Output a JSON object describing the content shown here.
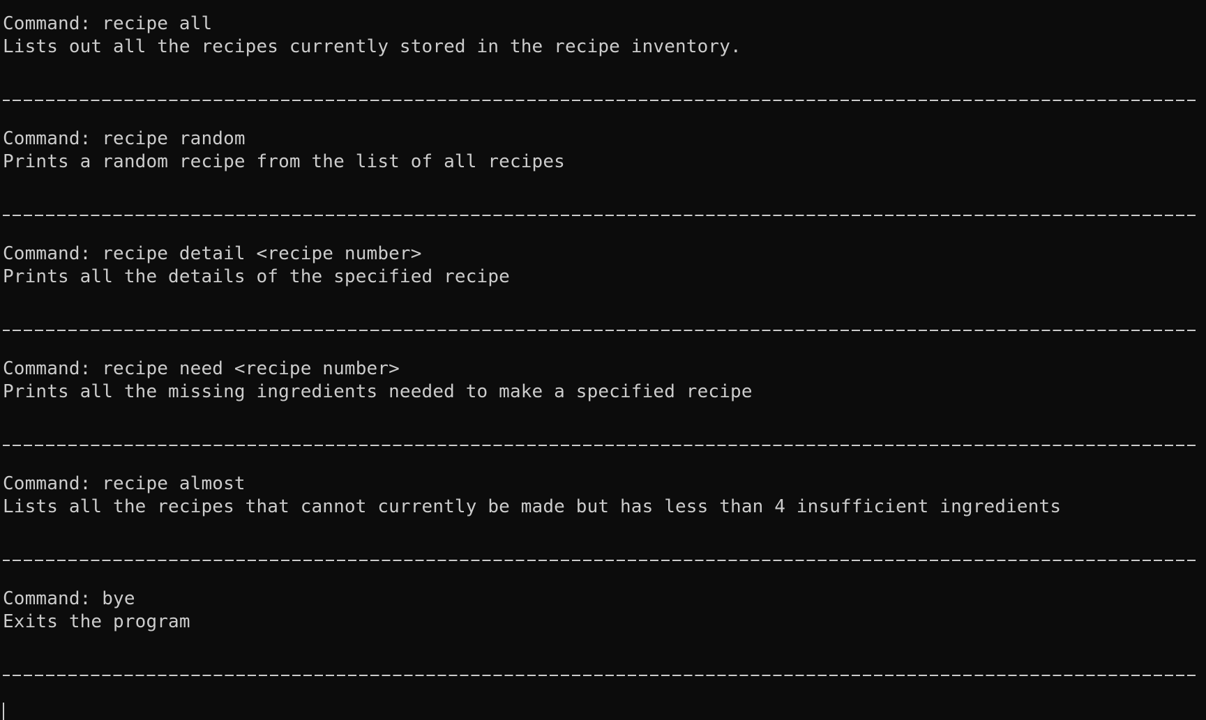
{
  "terminal": {
    "entries": [
      {
        "command": "Command: recipe all",
        "description": "Lists out all the recipes currently stored in the recipe inventory."
      },
      {
        "command": "Command: recipe random",
        "description": "Prints a random recipe from the list of all recipes"
      },
      {
        "command": "Command: recipe detail <recipe number>",
        "description": "Prints all the details of the specified recipe"
      },
      {
        "command": "Command: recipe need <recipe number>",
        "description": "Prints all the missing ingredients needed to make a specified recipe"
      },
      {
        "command": "Command: recipe almost",
        "description": "Lists all the recipes that cannot currently be made but has less than 4 insufficient ingredients"
      },
      {
        "command": "Command: bye",
        "description": "Exits the program"
      }
    ]
  }
}
